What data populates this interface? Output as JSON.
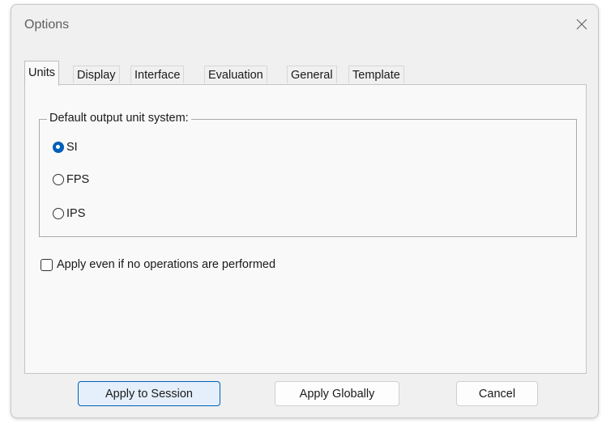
{
  "window": {
    "title": "Options"
  },
  "tabs": [
    {
      "label": "Units",
      "active": true
    },
    {
      "label": "Display",
      "active": false
    },
    {
      "label": "Interface",
      "active": false
    },
    {
      "label": "Evaluation",
      "active": false
    },
    {
      "label": "General",
      "active": false
    },
    {
      "label": "Template",
      "active": false
    }
  ],
  "units": {
    "group_label": "Default output unit system:",
    "options": [
      {
        "label": "SI",
        "selected": true
      },
      {
        "label": "FPS",
        "selected": false
      },
      {
        "label": "IPS",
        "selected": false
      }
    ],
    "apply_checkbox": {
      "label": "Apply even if no operations are performed",
      "checked": false
    }
  },
  "buttons": {
    "apply_session": "Apply to Session",
    "apply_globally": "Apply Globally",
    "cancel": "Cancel"
  },
  "colors": {
    "accent": "#005fb8",
    "window_bg": "#f0f0f0",
    "panel_bg": "#f9f9f9"
  },
  "icons": {
    "close": "close-icon"
  }
}
